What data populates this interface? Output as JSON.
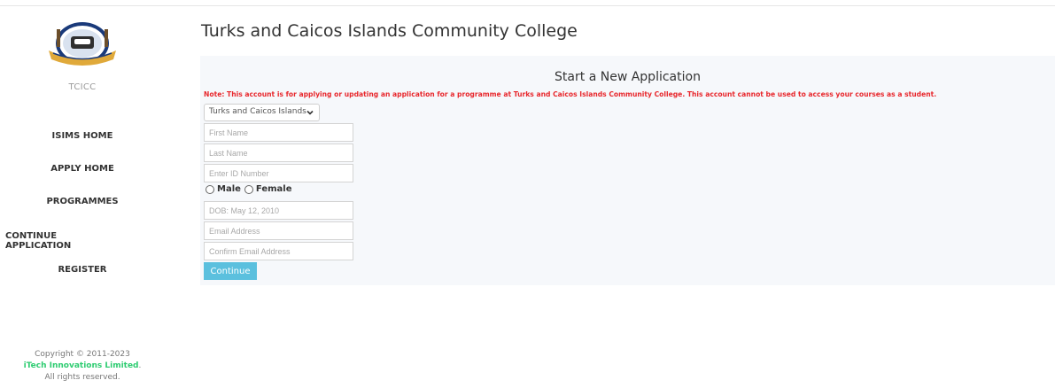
{
  "sidebar": {
    "logo_icon": "college-seal-icon",
    "brand": "TCICC",
    "nav": [
      {
        "label": "ISIMS HOME"
      },
      {
        "label": "APPLY HOME"
      },
      {
        "label": "PROGRAMMES"
      },
      {
        "label": "CONTINUE APPLICATION"
      },
      {
        "label": "REGISTER"
      }
    ],
    "copyright": {
      "line1": "Copyright © 2011-2023",
      "company": "iTech Innovations Limited",
      "period": ".",
      "line3": "All rights reserved."
    }
  },
  "main": {
    "college_title": "Turks and Caicos Islands Community College",
    "form": {
      "title": "Start a New Application",
      "note": "Note: This account is for applying or updating an application for a programme at Turks and Caicos Islands Community College. This account cannot be used to access your courses as a student.",
      "country_selected": "Turks and Caicos Islands",
      "first_name_placeholder": "First Name",
      "last_name_placeholder": "Last Name",
      "id_placeholder": "Enter ID Number",
      "gender_male": "Male",
      "gender_female": "Female",
      "dob_placeholder": "DOB: May 12, 2010",
      "email_placeholder": "Email Address",
      "confirm_email_placeholder": "Confirm Email Address",
      "continue_label": "Continue"
    }
  },
  "colors": {
    "note_red": "#e8272c",
    "button_blue": "#5bc0de",
    "company_green": "#2ecc71",
    "panel_bg": "#f6f8fb"
  }
}
